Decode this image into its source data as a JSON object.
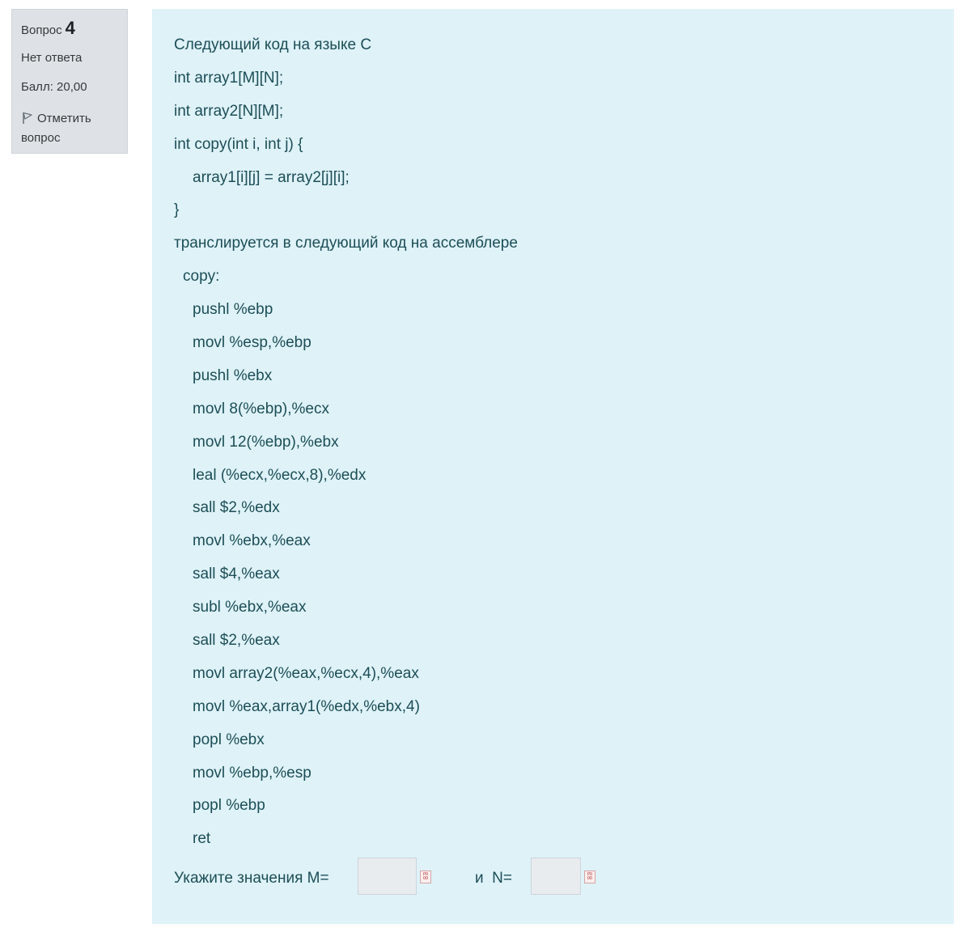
{
  "question_info": {
    "label": "Вопрос",
    "number": "4",
    "state": "Нет ответа",
    "grade": "Балл: 20,00",
    "flag_label": "Отметить вопрос"
  },
  "question_text": [
    "Следующий код на языке С",
    "int array1[M][N];",
    "int array2[N][M];",
    "int copy(int i, int j) {",
    "array1[i][j] = array2[j][i];",
    "}",
    "транслируется в следующий код на ассемблере",
    "copy:",
    "pushl %ebp",
    "movl %esp,%ebp",
    "pushl %ebx",
    "movl 8(%ebp),%ecx",
    "movl 12(%ebp),%ebx",
    "leal (%ecx,%ecx,8),%edx",
    "sall $2,%edx",
    "movl %ebx,%eax",
    "sall $4,%eax",
    "subl %ebx,%eax",
    "sall $2,%eax",
    "movl array2(%eax,%ecx,4),%eax",
    "movl %eax,array1(%edx,%ebx,4)",
    "popl %ebx",
    "movl %ebp,%esp",
    "popl %ebp",
    "ret"
  ],
  "answer": {
    "prompt": "Укажите значения M=",
    "m_value": "",
    "and_label": "и  N=",
    "n_value": "",
    "feedback_icon_text": "РО ОО"
  },
  "colors": {
    "info_bg": "#dee2e6",
    "formulation_bg": "#def2f8",
    "text": "#1d4e57",
    "input_bg": "#e9ecef"
  }
}
